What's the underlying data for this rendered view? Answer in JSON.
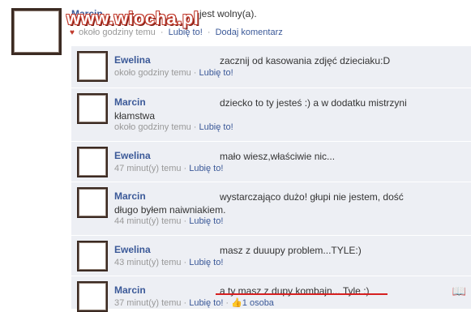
{
  "watermark": "www.wiocha.pl",
  "post": {
    "author": "Marcin",
    "text": "jest wolny(a).",
    "time": "około godziny temu",
    "like": "Lubię to!",
    "comment": "Dodaj komentarz"
  },
  "comments": [
    {
      "author": "Ewelina",
      "text": "zacznij od kasowania zdjęć dzieciaku:D",
      "time": "około godziny temu",
      "like": "Lubię to!"
    },
    {
      "author": "Marcin",
      "text": "dziecko to ty jesteś :) a w dodatku mistrzyni kłamstwa",
      "time": "około godziny temu",
      "like": "Lubię to!"
    },
    {
      "author": "Ewelina",
      "text": "mało wiesz,właściwie nic...",
      "time": "47 minut(y) temu",
      "like": "Lubię to!"
    },
    {
      "author": "Marcin",
      "text": "wystarczająco dużo! głupi nie jestem, dość długo byłem naiwniakiem.",
      "time": "44 minut(y) temu",
      "like": "Lubię to!"
    },
    {
      "author": "Ewelina",
      "text": "masz z duuupy problem...TYLE:)",
      "time": "43 minut(y) temu",
      "like": "Lubię to!"
    },
    {
      "author": "Marcin",
      "text": "a ty masz z dupy kombajn... Tyle :)",
      "time": "37 minut(y) temu",
      "like": "Lubię to!",
      "likes_count": "1 osoba"
    }
  ],
  "colors": {
    "link": "#3b5998",
    "meta": "#999999",
    "comment_bg": "#edeff4",
    "highlight": "#d62020"
  }
}
